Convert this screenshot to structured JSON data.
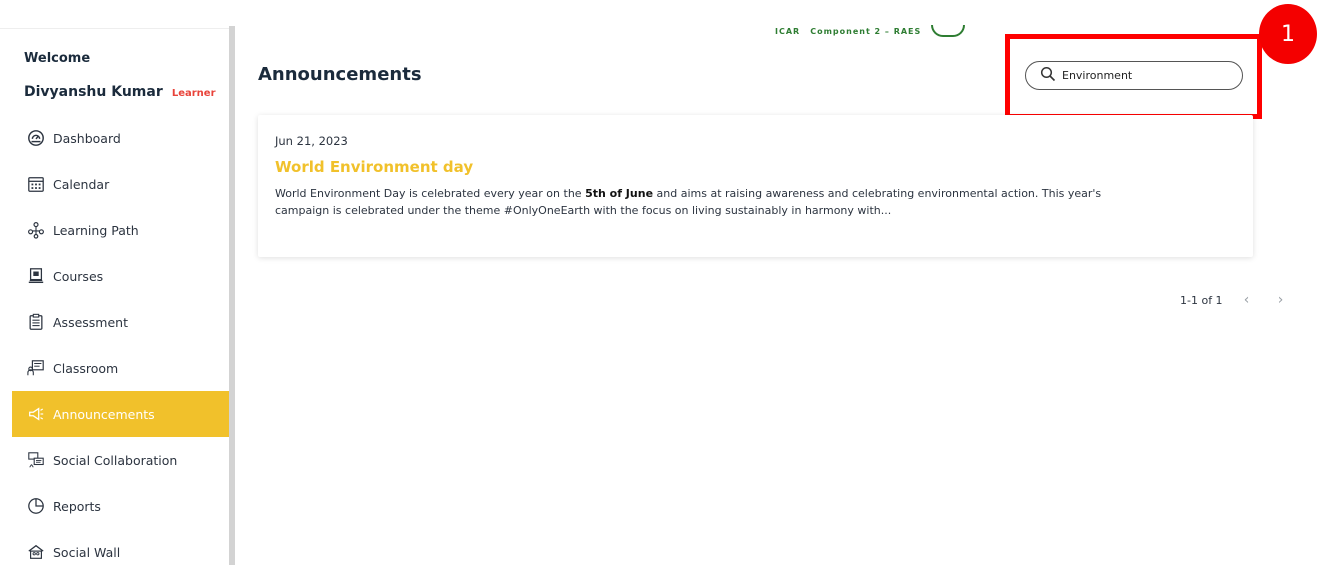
{
  "sidebar": {
    "welcome": "Welcome",
    "user_name": "Divyanshu Kumar",
    "user_role": "Learner",
    "items": [
      {
        "label": "Dashboard",
        "icon": "dashboard-icon"
      },
      {
        "label": "Calendar",
        "icon": "calendar-icon"
      },
      {
        "label": "Learning Path",
        "icon": "learning-path-icon"
      },
      {
        "label": "Courses",
        "icon": "courses-icon"
      },
      {
        "label": "Assessment",
        "icon": "assessment-icon"
      },
      {
        "label": "Classroom",
        "icon": "classroom-icon"
      },
      {
        "label": "Announcements",
        "icon": "megaphone-icon",
        "active": true
      },
      {
        "label": "Social Collaboration",
        "icon": "social-collaboration-icon"
      },
      {
        "label": "Reports",
        "icon": "pie-chart-icon"
      },
      {
        "label": "Social Wall",
        "icon": "social-wall-icon"
      }
    ]
  },
  "header": {
    "logo_text_1": "ICAR",
    "logo_text_2": "Component 2 – RAES"
  },
  "main": {
    "title": "Announcements",
    "search": {
      "value": "Environment",
      "icon": "search-icon"
    },
    "annotation_marker": "1",
    "announcement": {
      "date": "Jun 21, 2023",
      "title": "World Environment day",
      "body_prefix": "World Environment Day is celebrated every year on the ",
      "body_bold": "5th of June",
      "body_suffix": " and aims at raising awareness and celebrating environmental action. This year's campaign is celebrated under the theme #OnlyOneEarth with the focus on living sustainably in harmony with..."
    },
    "pagination": {
      "range": "1-1 of 1",
      "prev": "‹",
      "next": "›"
    }
  },
  "colors": {
    "accent": "#f1c12b",
    "role": "#e8433a",
    "highlight": "#ff0000"
  }
}
